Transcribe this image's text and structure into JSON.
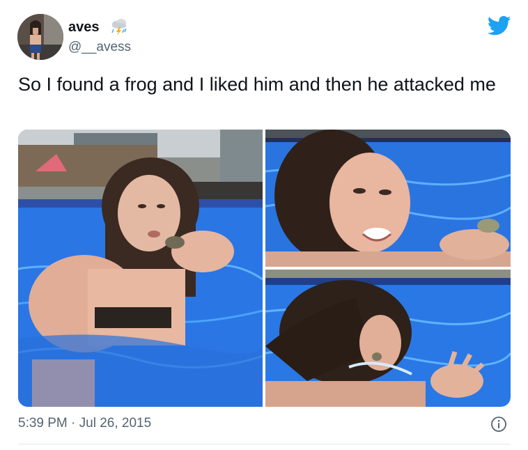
{
  "author": {
    "name": "aves",
    "handle": "@__avess",
    "name_emoji": "cloud-with-lightning-and-rain-icon"
  },
  "tweet": {
    "text": "So I found a frog and I liked him and then he attacked me",
    "timestamp": "5:39 PM · Jul 26, 2015"
  },
  "media": {
    "count": 3
  },
  "colors": {
    "brand": "#1da1f2",
    "text": "#0f1419",
    "secondary": "#536471",
    "pool": "#1f66d9"
  },
  "icons": [
    "twitter-bird-icon",
    "info-icon",
    "cloud-with-lightning-and-rain-icon"
  ]
}
